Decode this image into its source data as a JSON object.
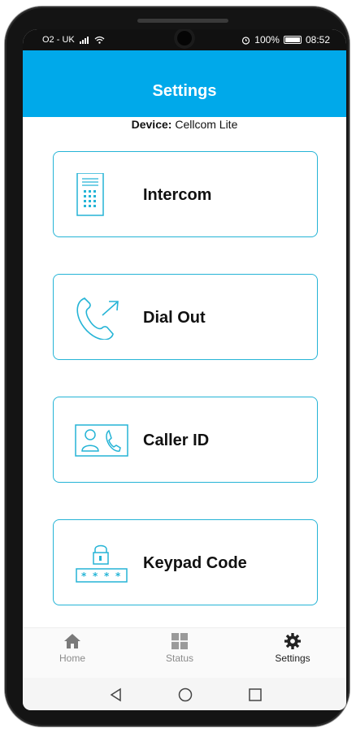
{
  "status_bar": {
    "carrier": "O2 - UK",
    "battery": "100%",
    "time": "08:52"
  },
  "header": {
    "title": "Settings"
  },
  "device": {
    "label": "Device:",
    "name": "Cellcom Lite"
  },
  "menu": {
    "items": [
      {
        "label": "Intercom",
        "icon": "intercom-panel-icon"
      },
      {
        "label": "Dial Out",
        "icon": "phone-outgoing-icon"
      },
      {
        "label": "Caller ID",
        "icon": "caller-id-icon"
      },
      {
        "label": "Keypad Code",
        "icon": "keypad-lock-icon"
      }
    ]
  },
  "tabs": [
    {
      "label": "Home",
      "icon": "home-icon",
      "active": false
    },
    {
      "label": "Status",
      "icon": "grid-icon",
      "active": false
    },
    {
      "label": "Settings",
      "icon": "gear-icon",
      "active": true
    }
  ],
  "colors": {
    "accent": "#00a9ea",
    "card_border": "#25b4d6"
  }
}
